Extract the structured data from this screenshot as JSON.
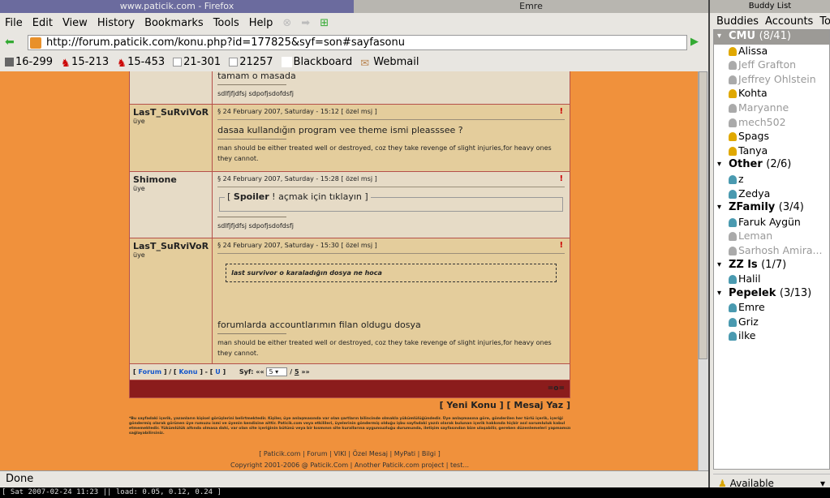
{
  "window_titles": {
    "firefox": "www.paticik.com - Firefox",
    "other": "Emre",
    "buddy_list": "Buddy List"
  },
  "menu": [
    "File",
    "Edit",
    "View",
    "History",
    "Bookmarks",
    "Tools",
    "Help"
  ],
  "url": "http://forum.paticik.com/konu.php?id=177825&syf=son#sayfasonu",
  "bookmarks": [
    "16-299",
    "15-213",
    "15-453",
    "21-301",
    "21257",
    "Blackboard",
    "Webmail"
  ],
  "posts": [
    {
      "body": "tamam o masada",
      "sig": "sdlfjfjdfsj sdpofjsdofdsfj"
    },
    {
      "user": "LasT_SuRviVoR",
      "role": "üye",
      "header": "§ 24 February 2007, Saturday - 15:12   [ özel msj ]",
      "body": "dasaa kullandığın program vee theme ismi pleasssee ?",
      "sig": "man should be either treated well or destroyed, coz they take revenge of slight injuries,for heavy ones they cannot."
    },
    {
      "user": "Shimone",
      "role": "üye",
      "header": "§ 24 February 2007, Saturday - 15:28   [ özel msj ]",
      "spoiler_bold": "Spoiler",
      "spoiler_rest": " ! açmak için tıklayın ]",
      "spoiler_open": "[ ",
      "sig": "sdlfjfjdfsj sdpofjsdofdsfj"
    },
    {
      "user": "LasT_SuRviVoR",
      "role": "üye",
      "header": "§ 24 February 2007, Saturday - 15:30   [ özel msj ]",
      "quote": "last survivor o karaladığın dosya ne hoca",
      "body": "forumlarda accountlarımın filan oldugu dosya",
      "sig": "man should be either treated well or destroyed, coz they take revenge of slight injuries,for heavy ones they cannot."
    }
  ],
  "pager": {
    "forum": "Forum",
    "konu": "Konu",
    "u": "U",
    "label": "Syf:",
    "prev": "««",
    "page": "5",
    "total": "5",
    "next": "»»"
  },
  "footer_mark": "=o=",
  "actions": "[ Yeni Konu ] [ Mesaj Yaz ]",
  "disclaimer": "*Bu sayfadaki içerik, yazanların kişisel görüşlerini belirtmektedir. Kişiler, üye anlaşmasında var olan şartların bilincinde olmakla yükümlülüğündedir. Üye anlaşmasına göre, gönderilen her türlü içerik, içeriği göndermiş olarak görünen üye rumuzu ismi ve üyenin kendisine aittir. Paticik.com veya etkilileri, üyelerinin göndermiş olduğu işbu sayfadaki yazılı olarak bulunan içerik hakkında hiçbir asıl sorumluluk kabul etmemektedir. Yükümlülük altında olmasa dahi, var olan site içeriğinin bütünü veya bir kısmının site kurallarına uygunsuzluğu durumunda, iletişim sayfasından bize ulaşabilir, gereken düzenlemeleri yapmamızı sağlayabilirsiniz.",
  "site_links": "[ Paticik.com | Forum | VIKI | Özel Mesaj | MyPati | Bilgi ]",
  "copyright": "Copyright 2001-2006 @ Paticik.Com | Another Paticik.com project | test...",
  "status": "Done",
  "terminal": "[ Sat 2007-02-24 11:23 || load: 0.05, 0.12, 0.24 ]",
  "buddy": {
    "menu": [
      "Buddies",
      "Accounts",
      "Tools"
    ],
    "status": "Available",
    "groups": [
      {
        "name": "CMU",
        "count": "(8/41)",
        "buddies": [
          {
            "n": "Alissa",
            "on": true
          },
          {
            "n": "Jeff Grafton",
            "on": false
          },
          {
            "n": "Jeffrey Ohlstein",
            "on": false
          },
          {
            "n": "Kohta",
            "on": true
          },
          {
            "n": "Maryanne",
            "on": false
          },
          {
            "n": "mech502",
            "on": false
          },
          {
            "n": "Spags",
            "on": true
          },
          {
            "n": "Tanya",
            "on": true
          }
        ]
      },
      {
        "name": "Other",
        "count": "(2/6)",
        "buddies": [
          {
            "n": "z",
            "on": true
          },
          {
            "n": "Zedya",
            "on": true
          }
        ]
      },
      {
        "name": "ZFamily",
        "count": "(3/4)",
        "buddies": [
          {
            "n": "Faruk Aygün",
            "on": true
          },
          {
            "n": "Leman",
            "on": false
          },
          {
            "n": "Sarhosh Amira...",
            "on": false
          }
        ]
      },
      {
        "name": "ZZ   ls",
        "count": "(1/7)",
        "buddies": [
          {
            "n": "Halil",
            "on": true
          }
        ]
      },
      {
        "name": "Pepelek",
        "count": "(3/13)",
        "buddies": [
          {
            "n": "Emre",
            "on": true
          },
          {
            "n": "Griz",
            "on": true
          },
          {
            "n": "ilke",
            "on": true
          }
        ]
      }
    ]
  },
  "colors": {
    "page_bg": "#f0913c",
    "footer_bar": "#8b1c1c",
    "post_light": "#e6dbc6",
    "post_tan": "#e4cd9c"
  }
}
